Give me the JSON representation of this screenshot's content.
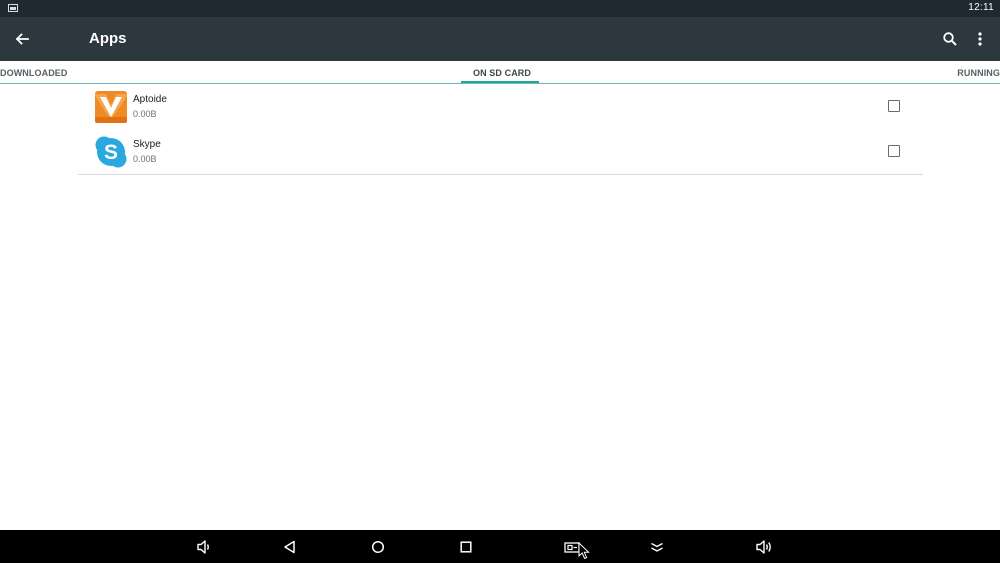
{
  "status_bar": {
    "time": "12:11",
    "notification_icon": "image-notification-icon"
  },
  "toolbar": {
    "title": "Apps",
    "back_icon": "arrow-back-icon",
    "search_icon": "search-icon",
    "more_icon": "more-vert-icon"
  },
  "tabs": [
    {
      "label": "DOWNLOADED",
      "selected": false
    },
    {
      "label": "ON SD CARD",
      "selected": true
    },
    {
      "label": "RUNNING",
      "selected": false
    }
  ],
  "apps": [
    {
      "name": "Aptoide",
      "size": "0.00B",
      "icon": "aptoide-logo-icon",
      "checked": false
    },
    {
      "name": "Skype",
      "size": "0.00B",
      "icon": "skype-logo-icon",
      "checked": false
    }
  ],
  "nav_bar": {
    "buttons": [
      "volume-down-icon",
      "back-triangle-icon",
      "home-circle-icon",
      "recents-square-icon",
      "screenshot-icon",
      "collapse-chevron-icon",
      "volume-up-icon"
    ]
  },
  "colors": {
    "status_bar": "#1f292f",
    "toolbar": "#2d373e",
    "tab_indicator": "#26a69a",
    "aptoide_orange": "#f08a24",
    "skype_blue": "#2aa8e0"
  }
}
